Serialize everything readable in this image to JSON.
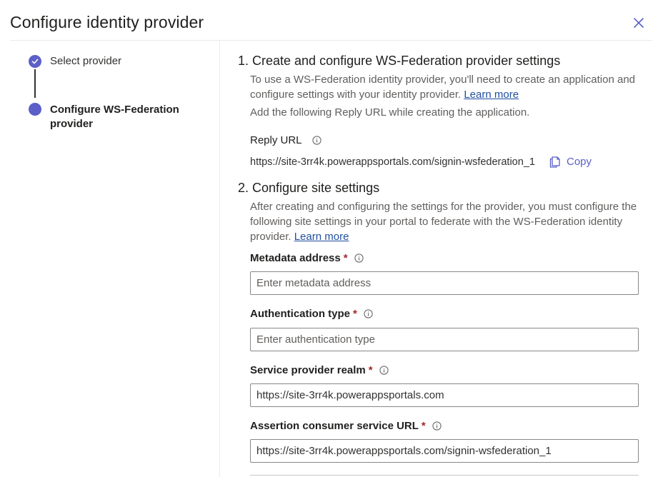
{
  "dialog": {
    "title": "Configure identity provider"
  },
  "stepper": {
    "steps": [
      {
        "label": "Select provider",
        "completed": true
      },
      {
        "label": "Configure WS-Federation provider",
        "active": true
      }
    ]
  },
  "section1": {
    "title": "1. Create and configure WS-Federation provider settings",
    "description": "To use a WS-Federation identity provider, you'll need to create an application and configure settings with your identity provider.",
    "learn_more": "Learn more",
    "instruction": "Add the following Reply URL while creating the application.",
    "reply_url_label": "Reply URL",
    "reply_url_value": "https://site-3rr4k.powerappsportals.com/signin-wsfederation_1",
    "copy_label": "Copy"
  },
  "section2": {
    "title": "2. Configure site settings",
    "description": "After creating and configuring the settings for the provider, you must configure the following site settings in your portal to federate with the WS-Federation identity provider.",
    "learn_more": "Learn more"
  },
  "fields": {
    "metadata": {
      "label": "Metadata address",
      "required_mark": "*",
      "placeholder": "Enter metadata address",
      "value": ""
    },
    "auth_type": {
      "label": "Authentication type",
      "required_mark": "*",
      "placeholder": "Enter authentication type",
      "value": ""
    },
    "realm": {
      "label": "Service provider realm",
      "required_mark": "*",
      "placeholder": "",
      "value": "https://site-3rr4k.powerappsportals.com"
    },
    "acs_url": {
      "label": "Assertion consumer service URL",
      "required_mark": "*",
      "placeholder": "",
      "value": "https://site-3rr4k.powerappsportals.com/signin-wsfederation_1"
    }
  },
  "icons": {
    "close": "close-icon",
    "info": "info-icon",
    "copy": "copy-icon",
    "check": "check-icon"
  },
  "colors": {
    "accent": "#5b5fc7",
    "link": "#1f4e9e",
    "required": "#a4262c"
  }
}
